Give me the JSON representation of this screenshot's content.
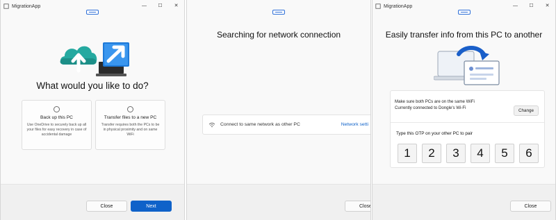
{
  "windows": [
    {
      "title": "MigrationApp",
      "controls": [
        "—",
        "☐",
        "✕"
      ],
      "heading": "What would you like to do?",
      "options": [
        {
          "title": "Back up this PC",
          "description": "Use OneDrive to securely back up all your files for easy recovery in case of accidental damage"
        },
        {
          "title": "Transfer files to a new PC",
          "description": "Transfer requires both the PCs to be in physical proximity and on same WiFi"
        }
      ],
      "close_label": "Close",
      "next_label": "Next"
    },
    {
      "title": "MigrationApp",
      "controls": [
        "—",
        "☐",
        "✕"
      ],
      "heading": "Searching for network connection",
      "network_row": {
        "label": "Connect to same network as other PC",
        "link": "Network setti"
      },
      "close_label": "Close"
    },
    {
      "title": "MigrationApp",
      "controls": [
        "—",
        "☐",
        "✕"
      ],
      "heading": "Easily transfer info from this PC to another",
      "wifi_line1": "Make sure both PCs are on the same WiFi",
      "wifi_line2": "Currently connected to Dongle's Wi-Fi",
      "change_label": "Change",
      "otp_label": "Type this OTP on your other PC to pair",
      "otp_digits": [
        "1",
        "2",
        "3",
        "4",
        "5",
        "6"
      ],
      "close_label": "Close"
    }
  ],
  "colors": {
    "accent": "#0f62c9",
    "grip": "#2e6fd8",
    "cloud": "#25a9a0",
    "footer": "#f0f0f0"
  }
}
